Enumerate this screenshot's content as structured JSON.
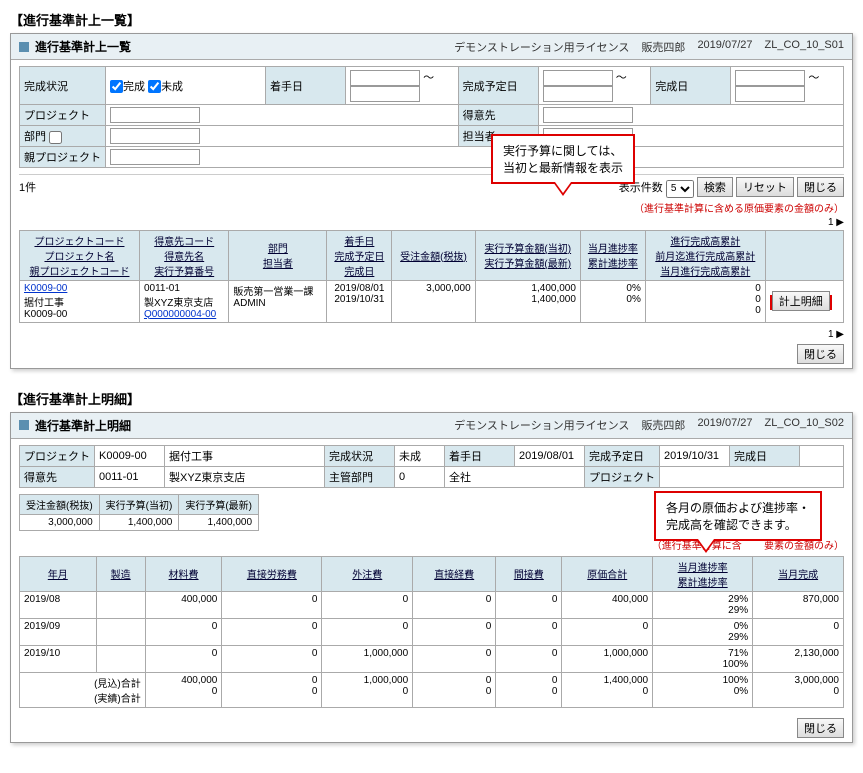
{
  "section1": {
    "heading": "【進行基準計上一覧】",
    "title": "進行基準計上一覧",
    "license": "デモンストレーション用ライセンス",
    "user": "販売四郎",
    "date": "2019/07/27",
    "screen_id": "ZL_CO_10_S01",
    "filters": {
      "status_label": "完成状況",
      "status_done": "完成",
      "status_undone": "未成",
      "start_label": "着手日",
      "plan_end_label": "完成予定日",
      "end_label": "完成日",
      "project_label": "プロジェクト",
      "customer_label": "得意先",
      "dept_label": "部門",
      "person_label": "担当者",
      "parent_label": "親プロジェクト",
      "tilde": "～"
    },
    "count": "1件",
    "display_count_label": "表示件数",
    "display_count_value": "5",
    "btn_search": "検索",
    "btn_reset": "リセット",
    "btn_close": "閉じる",
    "note": "（進行基準計算に含める原価要素の金額のみ）",
    "pager": "1",
    "headers": {
      "c1a": "プロジェクトコード",
      "c1b": "プロジェクト名",
      "c1c": "親プロジェクトコード",
      "c2a": "得意先コード",
      "c2b": "得意先名",
      "c2c": "実行予算番号",
      "c3a": "部門",
      "c3b": "担当者",
      "c4a": "着手日",
      "c4b": "完成予定日",
      "c4c": "完成日",
      "c5": "受注金額(税抜)",
      "c6a": "実行予算金額(当初)",
      "c6b": "実行予算金額(最新)",
      "c7a": "当月進捗率",
      "c7b": "累計進捗率",
      "c8a": "進行完成高累計",
      "c8b": "前月迄進行完成高累計",
      "c8c": "当月進行完成高累計"
    },
    "row": {
      "proj_code": "K0009-00",
      "proj_name": "据付工事",
      "parent_code": "K0009-00",
      "cust_code": "0011-01",
      "cust_name": "製XYZ東京支店",
      "budget_no": "Q000000004-00",
      "dept": "販売第一営業一課",
      "person": "ADMIN",
      "start": "2019/08/01",
      "plan_end": "2019/10/31",
      "end": "",
      "order_amt": "3,000,000",
      "budget_init": "1,400,000",
      "budget_latest": "1,400,000",
      "prog_month": "0%",
      "prog_total": "0%",
      "comp_total": "0",
      "comp_prev": "0",
      "comp_month": "0",
      "detail_btn": "計上明細"
    },
    "callout": "実行予算に関しては、\n当初と最新情報を表示"
  },
  "section2": {
    "heading": "【進行基準計上明細】",
    "title": "進行基準計上明細",
    "license": "デモンストレーション用ライセンス",
    "user": "販売四郎",
    "date": "2019/07/27",
    "screen_id": "ZL_CO_10_S02",
    "proj": {
      "project_label": "プロジェクト",
      "project_code": "K0009-00",
      "project_name": "据付工事",
      "status_label": "完成状況",
      "status": "未成",
      "start_label": "着手日",
      "start": "2019/08/01",
      "plan_end_label": "完成予定日",
      "plan_end": "2019/10/31",
      "end_label": "完成日",
      "end": "",
      "customer_label": "得意先",
      "customer_code": "0011-01",
      "customer_name": "製XYZ東京支店",
      "main_dept_label": "主管部門",
      "main_dept": "0",
      "company": "全社",
      "parent_label": "プロジェクト"
    },
    "summary": {
      "h1": "受注金額(税抜)",
      "h2": "実行予算(当初)",
      "h3": "実行予算(最新)",
      "v1": "3,000,000",
      "v2": "1,400,000",
      "v3": "1,400,000"
    },
    "note": "（進行基準計算に含",
    "note2": "要素の金額のみ）",
    "detail_headers": {
      "ym": "年月",
      "seizo": "製造",
      "zairyo": "材料費",
      "roumu": "直接労務費",
      "gaichu": "外注費",
      "keihi": "直接経費",
      "kansetsu": "間接費",
      "genka": "原価合計",
      "prog1": "当月進捗率",
      "prog2": "累計進捗率",
      "kansei": "当月完成"
    },
    "rows": [
      {
        "ym": "2019/08",
        "seizo": "",
        "zairyo": "400,000",
        "roumu": "0",
        "gaichu": "0",
        "keihi": "0",
        "kansetsu": "0",
        "genka": "400,000",
        "prog1": "29%",
        "prog2": "29%",
        "kansei": "870,000"
      },
      {
        "ym": "2019/09",
        "seizo": "",
        "zairyo": "0",
        "roumu": "0",
        "gaichu": "0",
        "keihi": "0",
        "kansetsu": "0",
        "genka": "0",
        "prog1": "0%",
        "prog2": "29%",
        "kansei": "0"
      },
      {
        "ym": "2019/10",
        "seizo": "",
        "zairyo": "0",
        "roumu": "0",
        "gaichu": "1,000,000",
        "keihi": "0",
        "kansetsu": "0",
        "genka": "1,000,000",
        "prog1": "71%",
        "prog2": "100%",
        "kansei": "2,130,000"
      }
    ],
    "totals": {
      "label1": "(見込)合計",
      "label2": "(実績)合計",
      "zairyo": "400,000",
      "roumu": "0",
      "gaichu": "1,000,000",
      "keihi": "0",
      "kansetsu": "0",
      "genka": "1,400,000",
      "prog1": "100%",
      "prog2": "100%",
      "kansei": "3,000,000",
      "zairyo2": "0",
      "roumu2": "0",
      "gaichu2": "0",
      "keihi2": "0",
      "kansetsu2": "0",
      "genka2": "0",
      "prog1b": "0%",
      "prog2b": "0%",
      "kansei2": "0"
    },
    "btn_close": "閉じる",
    "callout": "各月の原価および進捗率・\n完成高を確認できます。"
  }
}
